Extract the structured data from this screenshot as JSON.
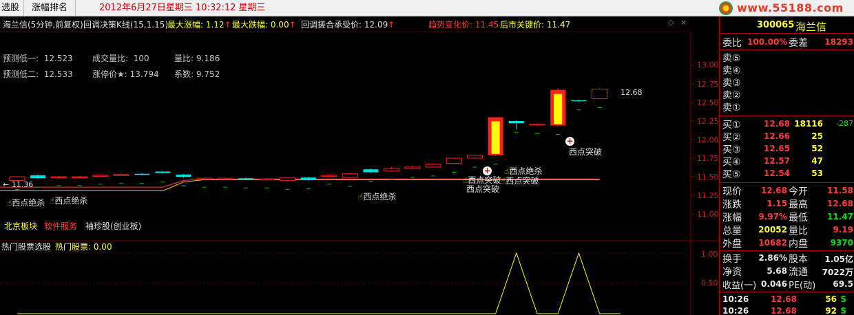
{
  "topbar": {
    "tab1": "选股",
    "tab2": "涨幅排名",
    "datetime": "2012年6月27日星期三  10:32:12 星期三",
    "logo": "www.55188.com"
  },
  "header": {
    "title": "海兰信(5分钟,前复权)",
    "indicator": "回调决策K线(15,1.15)",
    "max_rise_label": "最大涨幅: 1.12",
    "max_fall_label": "最大跌幅: 0.00",
    "pullback_label": "回调搓合承受价: 12.09",
    "trend_label": "趋势变化价: 11.45",
    "key_label": "后市关键价: 11.47"
  },
  "info": {
    "row1": [
      {
        "k": "预测低一:",
        "v": "12.523"
      },
      {
        "k": "成交量比:",
        "v": "100"
      },
      {
        "k": "量比:",
        "v": "9.186"
      }
    ],
    "row2": [
      {
        "k": "预测低二:",
        "v": "12.533"
      },
      {
        "k": "涨停价★:",
        "v": "13.794"
      },
      {
        "k": "系数:",
        "v": "9.752"
      }
    ]
  },
  "yaxis": {
    "labels": [
      "13.00",
      "12.75",
      "12.50",
      "12.25",
      "12.00",
      "11.75",
      "11.50",
      "11.25",
      "11.00"
    ],
    "min": 11.0,
    "max": 13.0
  },
  "lower_yaxis": {
    "labels": [
      "1.00",
      "0.50"
    ]
  },
  "chart_data": {
    "type": "candlestick",
    "candles": [
      {
        "o": 11.45,
        "c": 11.5,
        "h": 11.5,
        "l": 11.44
      },
      {
        "o": 11.52,
        "c": 11.48,
        "h": 11.53,
        "l": 11.47
      },
      {
        "o": 11.5,
        "c": 11.5,
        "h": 11.51,
        "l": 11.49
      },
      {
        "o": 11.5,
        "c": 11.5,
        "h": 11.51,
        "l": 11.49
      },
      {
        "o": 11.52,
        "c": 11.52,
        "h": 11.52,
        "l": 11.51
      },
      {
        "o": 11.53,
        "c": 11.53,
        "h": 11.55,
        "l": 11.52
      },
      {
        "o": 11.54,
        "c": 11.53,
        "h": 11.55,
        "l": 11.52
      },
      {
        "o": 11.57,
        "c": 11.55,
        "h": 11.58,
        "l": 11.54
      },
      {
        "o": 11.53,
        "c": 11.5,
        "h": 11.54,
        "l": 11.49
      },
      {
        "o": 11.48,
        "c": 11.48,
        "h": 11.49,
        "l": 11.47
      },
      {
        "o": 11.48,
        "c": 11.48,
        "h": 11.49,
        "l": 11.47
      },
      {
        "o": 11.48,
        "c": 11.47,
        "h": 11.49,
        "l": 11.46
      },
      {
        "o": 11.47,
        "c": 11.47,
        "h": 11.48,
        "l": 11.46
      },
      {
        "o": 11.45,
        "c": 11.49,
        "h": 11.49,
        "l": 11.44
      },
      {
        "o": 11.49,
        "c": 11.46,
        "h": 11.5,
        "l": 11.45
      },
      {
        "o": 11.52,
        "c": 11.52,
        "h": 11.53,
        "l": 11.5
      },
      {
        "o": 11.49,
        "c": 11.54,
        "h": 11.55,
        "l": 11.48
      },
      {
        "o": 11.6,
        "c": 11.56,
        "h": 11.61,
        "l": 11.55
      },
      {
        "o": 11.58,
        "c": 11.61,
        "h": 11.63,
        "l": 11.57
      },
      {
        "o": 11.61,
        "c": 11.63,
        "h": 11.65,
        "l": 11.6
      },
      {
        "o": 11.63,
        "c": 11.67,
        "h": 11.68,
        "l": 11.62
      },
      {
        "o": 11.68,
        "c": 11.75,
        "h": 11.76,
        "l": 11.67
      },
      {
        "o": 11.75,
        "c": 11.79,
        "h": 11.8,
        "l": 11.74
      },
      {
        "o": 11.79,
        "c": 12.3,
        "h": 12.3,
        "l": 11.78
      },
      {
        "o": 12.25,
        "c": 12.22,
        "h": 12.26,
        "l": 12.14
      },
      {
        "o": 12.2,
        "c": 12.21,
        "h": 12.22,
        "l": 12.18
      },
      {
        "o": 12.19,
        "c": 12.67,
        "h": 12.69,
        "l": 12.18
      },
      {
        "o": 12.53,
        "c": 12.52,
        "h": 12.54,
        "l": 12.51
      },
      {
        "o": 12.55,
        "c": 12.68,
        "h": 12.7,
        "l": 12.55
      }
    ],
    "last_price_label": "12.68",
    "left_price_label": "← 11.36",
    "lower_series": [
      0,
      0,
      0,
      0,
      0,
      0,
      0,
      0,
      0,
      0,
      0,
      0,
      0,
      0,
      0,
      0,
      0,
      0,
      0,
      0,
      0,
      0,
      0,
      0,
      1,
      0,
      0,
      1,
      0,
      0
    ]
  },
  "signals": [
    {
      "text": "西点绝杀",
      "icon": "hand"
    },
    {
      "text": "西点绝杀",
      "icon": "hand"
    },
    {
      "text": "西点绝杀",
      "icon": "hand"
    },
    {
      "text": "西点突破",
      "icon": "hand"
    },
    {
      "text": "西点突破",
      "icon": "plus"
    },
    {
      "text": "西点绝杀",
      "icon": "hand"
    },
    {
      "text": "西点突破",
      "icon": "hand"
    },
    {
      "text": "西点突破",
      "icon": "plus"
    }
  ],
  "bottom_links": {
    "l1": "北京板块",
    "l2": "软件服务",
    "l3": "袖珍股(创业板)"
  },
  "lower_header": {
    "title": "热门股票选股",
    "value_label": "热门股票: 0.00"
  },
  "quote": {
    "code": "300065",
    "name": "海兰信",
    "wb_label": "委比",
    "wb_val": "100.00%",
    "wc_label": "委差",
    "wc_val": "18293",
    "sells": [
      "卖⑤",
      "卖④",
      "卖③",
      "卖②",
      "卖①"
    ],
    "buys": [
      {
        "label": "买①",
        "price": "12.68",
        "vol": "18116",
        "chg": "-287"
      },
      {
        "label": "买②",
        "price": "12.66",
        "vol": "25",
        "chg": ""
      },
      {
        "label": "买③",
        "price": "12.65",
        "vol": "52",
        "chg": ""
      },
      {
        "label": "买④",
        "price": "12.57",
        "vol": "47",
        "chg": ""
      },
      {
        "label": "买⑤",
        "price": "12.54",
        "vol": "53",
        "chg": ""
      }
    ],
    "stats": [
      {
        "l1": "现价",
        "v1": "12.68",
        "l2": "今开",
        "v2": "11.58"
      },
      {
        "l1": "涨跌",
        "v1": "1.15",
        "l2": "最高",
        "v2": "12.68"
      },
      {
        "l1": "涨幅",
        "v1": "9.97%",
        "l2": "最低",
        "v2": "11.47"
      },
      {
        "l1": "总量",
        "v1": "20052",
        "l2": "量比",
        "v2": "9.19"
      },
      {
        "l1": "外盘",
        "v1": "10682",
        "l2": "内盘",
        "v2": "9370"
      }
    ],
    "fund": [
      {
        "l1": "换手",
        "v1": "2.86%",
        "l2": "股本",
        "v2": "1.05亿"
      },
      {
        "l1": "净资",
        "v1": "5.68",
        "l2": "流通",
        "v2": "7022万"
      },
      {
        "l1": "收益(一)",
        "v1": "0.046",
        "l2": "PE(动)",
        "v2": "69.5"
      }
    ],
    "ticks": [
      {
        "time": "10:26",
        "price": "12.68",
        "vol": "56",
        "bs": "S"
      },
      {
        "time": "10:26",
        "price": "12.68",
        "vol": "92",
        "bs": "S"
      }
    ]
  },
  "colors": {
    "up": "#ff2020",
    "down": "#00e0e0",
    "yellow": "#ffff00",
    "grid": "#800000"
  }
}
